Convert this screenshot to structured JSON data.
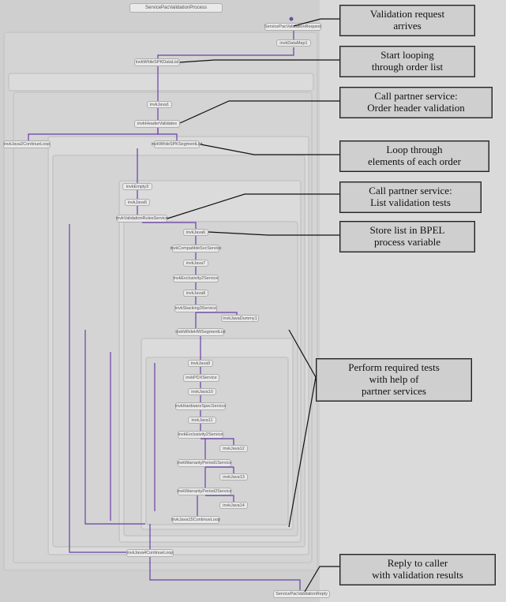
{
  "process_title": "ServicePacValidationProcess",
  "nodes": {
    "receive": "ServicePacValidationRequest",
    "map1": "invkDataMap1",
    "whileSPK": "invkWhileSPKDataList",
    "java1": "invkJava1",
    "hdrVal": "invkHeaderValidates",
    "j2cont": "invkJava2ContinueLoop",
    "whileSeg": "invkWhileSPKSegmentList",
    "empty3": "invkEmpty3",
    "java5": "invkJava5",
    "rules": "invkValidationRulesService",
    "java6": "invkJava6",
    "compSvc": "invkCompatibleSvcService",
    "java7": "invkJava7",
    "excl2": "invkExclusivity2Service",
    "java8": "invkJava8",
    "stack3": "invkStacking3Service",
    "dummy1": "invkJavaDummy1",
    "whileHW": "invkWhileHWSegmentList",
    "java9": "invkJava9",
    "pdxSvc": "invkPDXService",
    "java10": "invkJava10",
    "hwSpec": "invkHardwareSpecService",
    "java11": "invkJava11",
    "excl2b": "invkExclusivity2Service",
    "java12": "invkJava12",
    "wP1": "invkWarrantyPeriod1Service",
    "java13": "invkJava13",
    "wP2": "invkWarrantyPeriod2Service",
    "java14": "invkJava14",
    "j15cont": "invkJava15ContinueLoop",
    "j4cont": "invkJava4ContinueLoop",
    "reply": "ServicePacValidationReply"
  },
  "callouts": {
    "c1": "Validation request\narrives",
    "c2": "Start looping\nthrough order list",
    "c3": "Call partner service:\nOrder header validation",
    "c4": "Loop through\nelements of each order",
    "c5": "Call partner service:\nList validation tests",
    "c6": "Store list in BPEL\nprocess variable",
    "c7": "Perform required tests\nwith help of\npartner services",
    "c8": "Reply to caller\nwith validation results"
  }
}
